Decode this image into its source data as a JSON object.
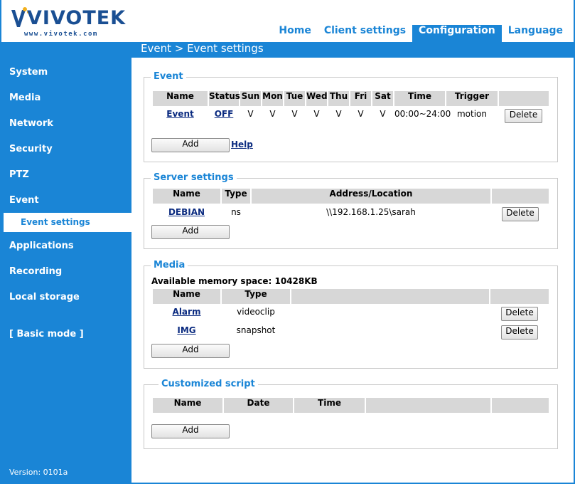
{
  "brand": {
    "name": "VIVOTEK",
    "url": "www.vivotek.com"
  },
  "nav": {
    "home": "Home",
    "client": "Client settings",
    "config": "Configuration",
    "language": "Language"
  },
  "breadcrumb": "Event  > Event settings",
  "sidebar": {
    "system": "System",
    "media": "Media",
    "network": "Network",
    "security": "Security",
    "ptz": "PTZ",
    "event": "Event",
    "event_settings": "Event settings",
    "applications": "Applications",
    "recording": "Recording",
    "local_storage": "Local storage",
    "basic_mode": "[ Basic mode ]",
    "version": "Version: 0101a"
  },
  "event": {
    "legend": "Event",
    "headers": [
      "Name",
      "Status",
      "Sun",
      "Mon",
      "Tue",
      "Wed",
      "Thu",
      "Fri",
      "Sat",
      "Time",
      "Trigger"
    ],
    "row": {
      "name": "Event",
      "status": "OFF",
      "sun": "V",
      "mon": "V",
      "tue": "V",
      "wed": "V",
      "thu": "V",
      "fri": "V",
      "sat": "V",
      "time": "00:00~24:00",
      "trigger": "motion"
    },
    "delete": "Delete",
    "add": "Add",
    "help": "Help"
  },
  "server": {
    "legend": "Server settings",
    "headers": [
      "Name",
      "Type",
      "Address/Location"
    ],
    "row": {
      "name": "DEBIAN",
      "type": "ns",
      "address": "\\\\192.168.1.25\\sarah"
    },
    "delete": "Delete",
    "add": "Add"
  },
  "media": {
    "legend": "Media",
    "memory": "Available memory space: 10428KB",
    "headers": [
      "Name",
      "Type"
    ],
    "rows": [
      {
        "name": "Alarm",
        "type": "videoclip"
      },
      {
        "name": "IMG",
        "type": "snapshot"
      }
    ],
    "delete": "Delete",
    "add": "Add"
  },
  "script": {
    "legend": "Customized script",
    "headers": [
      "Name",
      "Date",
      "Time"
    ],
    "add": "Add"
  },
  "colors": {
    "accent": "#1a85d6",
    "header_bg": "#d7d7d7",
    "link": "#0b2b80"
  }
}
